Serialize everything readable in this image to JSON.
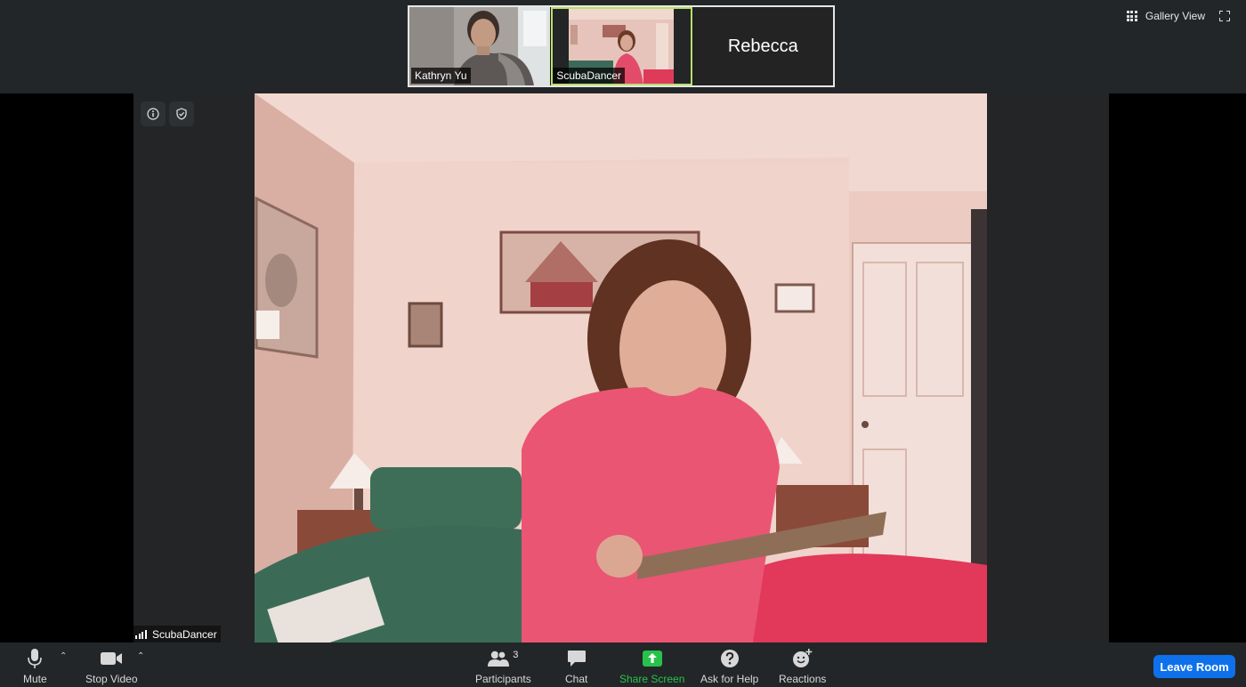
{
  "top_bar": {
    "participants": [
      {
        "name": "Kathryn Yu",
        "has_video": true,
        "active": false
      },
      {
        "name": "ScubaDancer",
        "has_video": true,
        "active": true
      },
      {
        "name": "Rebecca",
        "has_video": false,
        "active": false
      }
    ],
    "gallery_view_label": "Gallery View"
  },
  "main": {
    "active_speaker": "ScubaDancer"
  },
  "toolbar": {
    "mute_label": "Mute",
    "stop_video_label": "Stop Video",
    "participants_label": "Participants",
    "participants_count": "3",
    "chat_label": "Chat",
    "share_screen_label": "Share Screen",
    "ask_for_help_label": "Ask for Help",
    "reactions_label": "Reactions",
    "leave_room_label": "Leave Room"
  },
  "colors": {
    "toolbar_bg": "#232628",
    "share_green": "#27c24c",
    "leave_blue": "#0e71eb",
    "active_border": "#b9e06b"
  }
}
